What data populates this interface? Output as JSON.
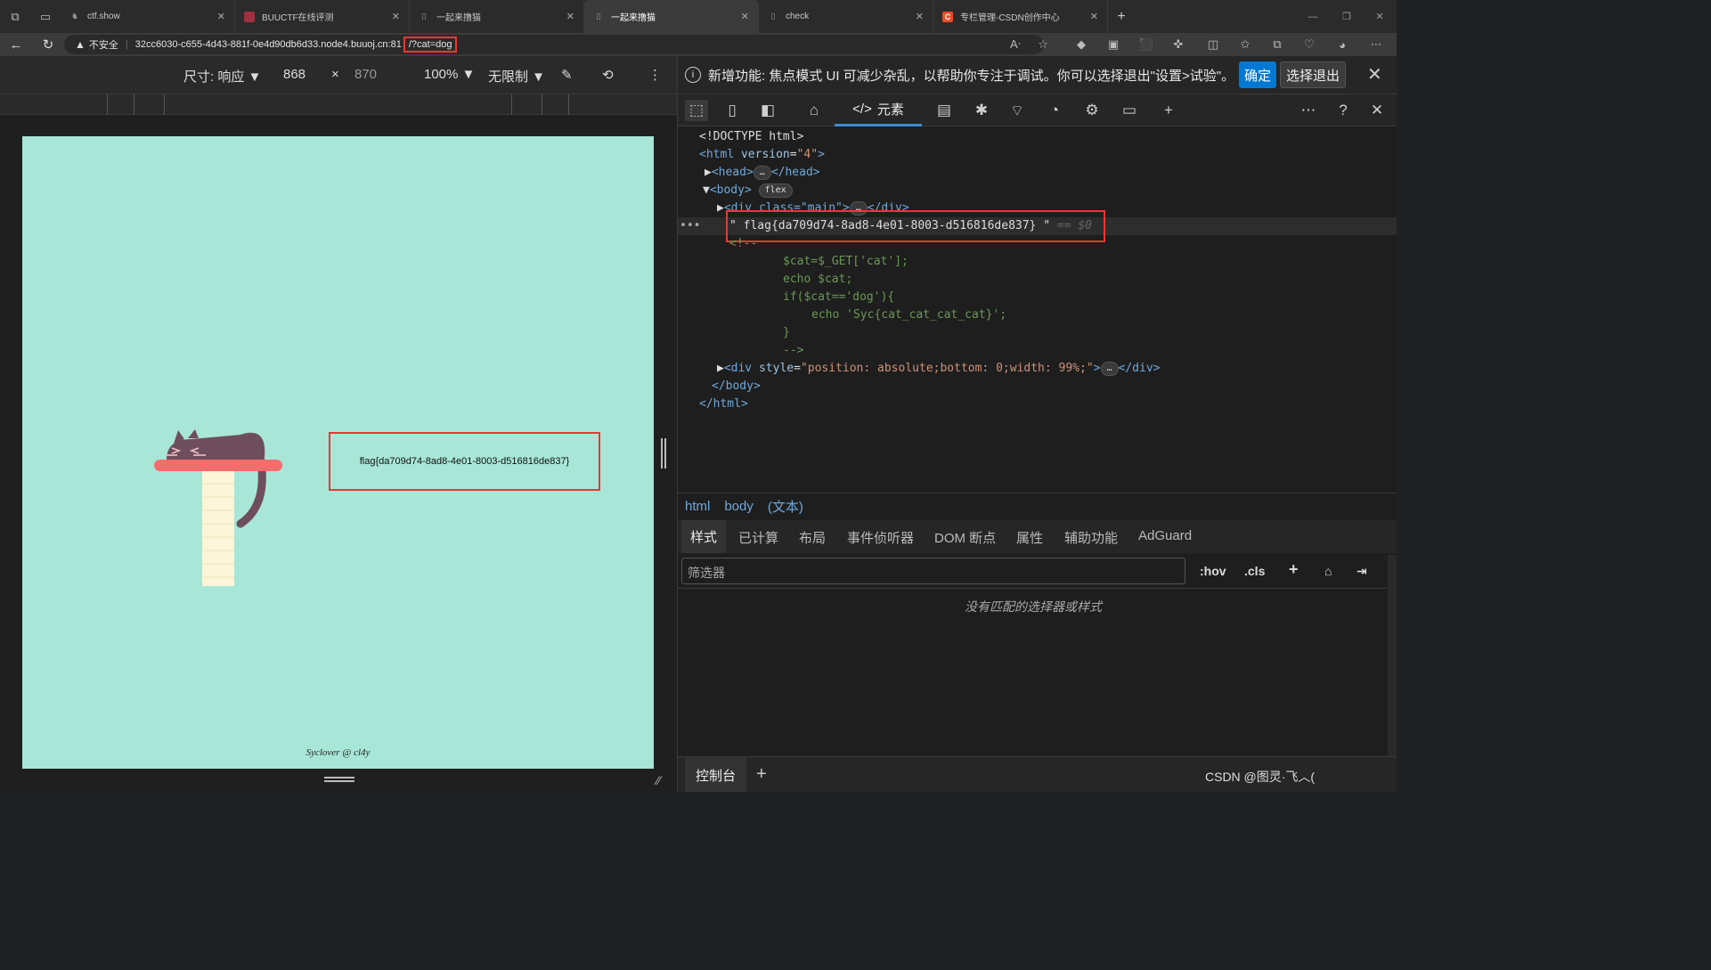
{
  "browser": {
    "tabs": [
      {
        "title": "ctf.show",
        "active": false
      },
      {
        "title": "BUUCTF在线评测",
        "active": false
      },
      {
        "title": "一起来撸猫",
        "active": false
      },
      {
        "title": "一起来撸猫",
        "active": true
      },
      {
        "title": "check",
        "active": false
      },
      {
        "title": "专栏管理-CSDN创作中心",
        "active": false
      }
    ],
    "security_label": "不安全",
    "url_host": "32cc6030-c655-4d43-881f-0e4d90db6d33.node4.buuoj.cn:81",
    "url_query": "/?cat=dog"
  },
  "device_toolbar": {
    "dimensions_label": "尺寸: 响应",
    "width": "868",
    "times": "×",
    "height": "870",
    "zoom": "100%",
    "throttle": "无限制"
  },
  "page": {
    "flag_text": "flag{da709d74-8ad8-4e01-8003-d516816de837}",
    "footer": "Syclover @ cl4y"
  },
  "devtools": {
    "banner_text": "新增功能: 焦点模式 UI 可减少杂乱，以帮助你专注于调试。你可以选择退出\"设置>试验\"。",
    "banner_ok": "确定",
    "banner_optout": "选择退出",
    "elements_tab": "元素",
    "dom": {
      "doctype": "<!DOCTYPE html>",
      "html_open_tag": "<html",
      "html_attr": " version",
      "html_attr_val": "\"4\"",
      "head": "<head>",
      "head_close": "</head>",
      "body": "<body>",
      "flex_badge": "flex",
      "div_main": "<div class=\"main\">",
      "div_close": "</div>",
      "flag_node": "\" flag{da709d74-8ad8-4e01-8003-d516816de837} \"",
      "dollar0": "== $0",
      "comment_open": "<!--",
      "php_1": "$cat=$_GET['cat'];",
      "php_2": "echo $cat;",
      "php_3": "if($cat=='dog'){",
      "php_4": "echo 'Syc{cat_cat_cat_cat}';",
      "php_5": "}",
      "comment_close": "-->",
      "div_style_open": "<div",
      "div_style_attr": " style",
      "div_style_val": "\"position: absolute;bottom: 0;width: 99%;\"",
      "body_close": "</body>",
      "html_close": "</html>"
    },
    "breadcrumbs": [
      "html",
      "body",
      "(文本)"
    ],
    "subtabs": [
      "样式",
      "已计算",
      "布局",
      "事件侦听器",
      "DOM 断点",
      "属性",
      "辅助功能",
      "AdGuard"
    ],
    "filter_placeholder": "筛选器",
    "hov": ":hov",
    "cls": ".cls",
    "no_match": "没有匹配的选择器或样式",
    "console_tab": "控制台",
    "watermark": "CSDN @图灵·飞︿("
  },
  "colors": {
    "page_bg": "#a8e6d8",
    "highlight_red": "#e53935",
    "accent_blue": "#0078d4"
  }
}
